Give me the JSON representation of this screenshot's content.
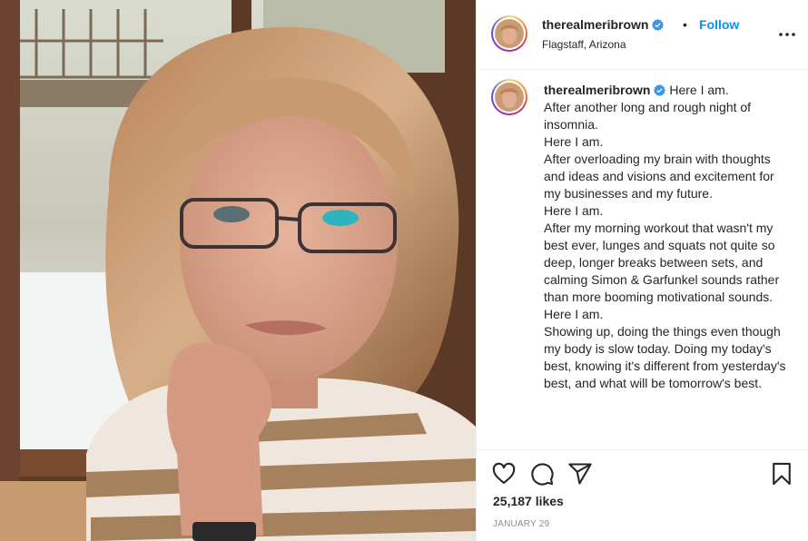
{
  "header": {
    "username": "therealmeribrown",
    "separator": "•",
    "follow_label": "Follow",
    "location": "Flagstaff, Arizona"
  },
  "caption": {
    "username": "therealmeribrown",
    "lines": [
      "Here I am.",
      "After another long and rough night of insomnia.",
      "Here I am.",
      "After overloading my brain with thoughts and ideas and visions and excitement for my businesses and my future.",
      "Here I am.",
      "After my morning workout that wasn't my best ever, lunges and squats not quite so deep, longer breaks between sets, and calming Simon & Garfunkel sounds rather than more booming motivational sounds.",
      "Here I am.",
      "Showing up, doing the things even though my body is slow today. Doing my today's best, knowing it's different from yesterday's best, and what will be tomorrow's best."
    ]
  },
  "stats": {
    "likes": "25,187 likes",
    "date": "JANUARY 29"
  },
  "icons": {
    "verified": "verified-badge-icon",
    "more": "more-options-icon",
    "like": "heart-icon",
    "comment": "comment-icon",
    "share": "share-icon",
    "save": "bookmark-icon"
  },
  "colors": {
    "link_blue": "#0095f6",
    "verified_blue": "#3897f0",
    "text": "#262626",
    "muted": "#8e8e8e"
  }
}
